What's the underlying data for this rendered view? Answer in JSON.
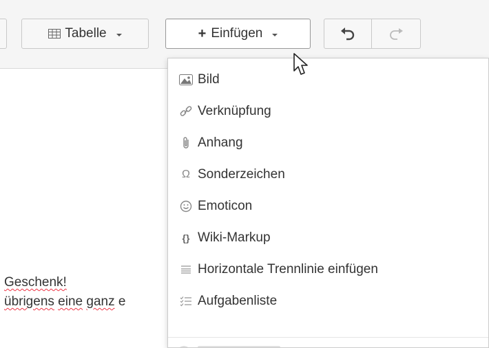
{
  "toolbar": {
    "table_label": "Tabelle",
    "insert_label": "Einfügen"
  },
  "editor": {
    "line1": "Geschenk!",
    "line2_words": [
      "übrigens",
      "eine",
      "ganz",
      "e"
    ]
  },
  "insert_menu": {
    "items": [
      {
        "label": "Bild",
        "icon": "image-icon"
      },
      {
        "label": "Verknüpfung",
        "icon": "link-icon"
      },
      {
        "label": "Anhang",
        "icon": "paperclip-icon"
      },
      {
        "label": "Sonderzeichen",
        "icon": "omega-icon"
      },
      {
        "label": "Emoticon",
        "icon": "smiley-icon"
      },
      {
        "label": "Wiki-Markup",
        "icon": "braces-icon"
      },
      {
        "label": "Horizontale Trennlinie einfügen",
        "icon": "horizontal-rule-icon"
      },
      {
        "label": "Aufgabenliste",
        "icon": "task-list-icon"
      }
    ]
  },
  "colors": {
    "toolbar_bg": "#f5f5f5",
    "spellcheck": "#e34",
    "menu_icon": "#888888"
  }
}
